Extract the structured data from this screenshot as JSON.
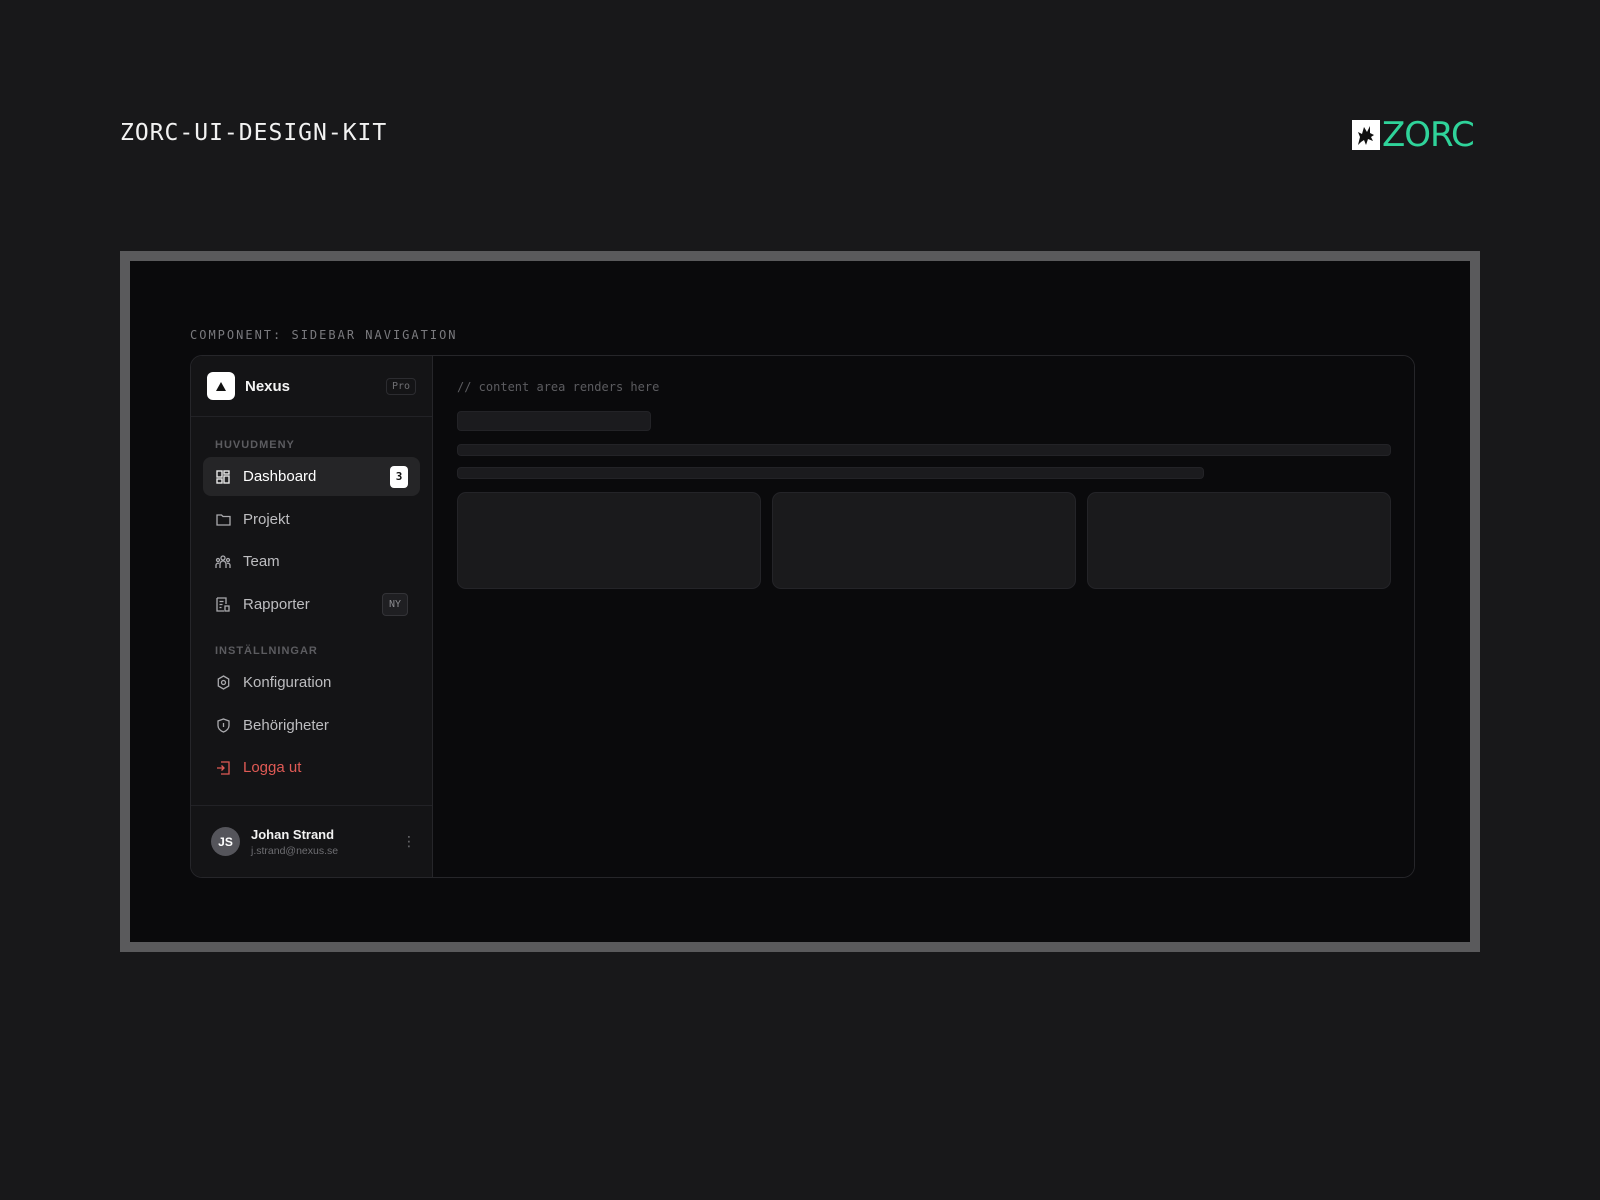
{
  "page": {
    "kit_title": "ZORC-UI-DESIGN-KIT",
    "logo_text": "ZORC",
    "logo_mark_icon": "wolf-icon",
    "accent_color": "#2fd39a"
  },
  "showcase": {
    "component_label": "COMPONENT: SIDEBAR NAVIGATION"
  },
  "sidebar": {
    "brand": {
      "name": "Nexus",
      "badge": "Pro",
      "icon": "triangle-logo-icon"
    },
    "sections": [
      {
        "label": "HUVUDMENY",
        "items": [
          {
            "label": "Dashboard",
            "icon": "dashboard-icon",
            "badge": "3",
            "active": true
          },
          {
            "label": "Projekt",
            "icon": "folder-icon"
          },
          {
            "label": "Team",
            "icon": "team-icon"
          },
          {
            "label": "Rapporter",
            "icon": "report-icon",
            "badge": "NY"
          }
        ]
      },
      {
        "label": "INSTÄLLNINGAR",
        "items": [
          {
            "label": "Konfiguration",
            "icon": "gear-icon"
          },
          {
            "label": "Behörigheter",
            "icon": "shield-icon"
          },
          {
            "label": "Logga ut",
            "icon": "logout-icon",
            "danger_color": "#e05a55"
          }
        ]
      }
    ],
    "user": {
      "initials": "JS",
      "name": "Johan Strand",
      "email": "j.strand@nexus.se"
    }
  },
  "content": {
    "comment": "// content area renders here"
  }
}
